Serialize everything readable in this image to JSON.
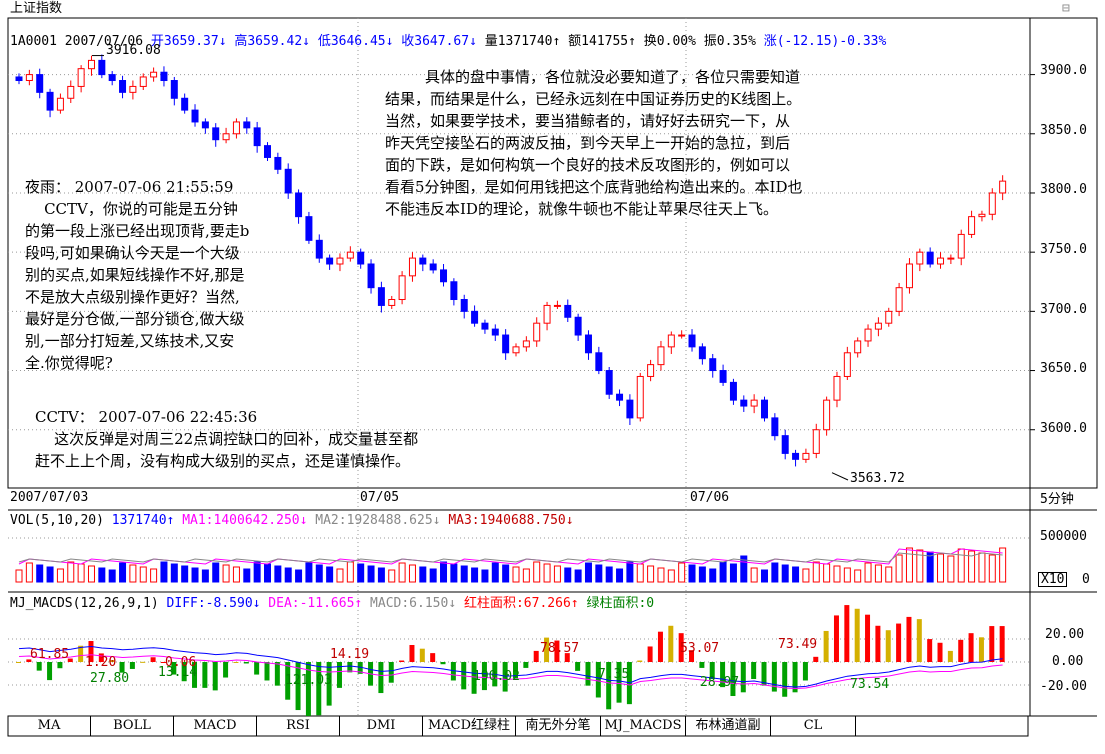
{
  "app_title": "上证指数",
  "corner_icon": "restore-icon",
  "info_line": {
    "code": "1A0001",
    "date": "2007/07/06",
    "open": "开3659.37",
    "high": "高3659.42",
    "low": "低3646.45",
    "close": "收3647.67",
    "volume": "量1371740",
    "amount": "额141755",
    "turnover": "换0.00%",
    "amplitude": "振0.35%",
    "change": "涨(-12.15)-0.33%",
    "arrow_down": "↓",
    "arrow_up": "↑"
  },
  "price_axis": [
    "3900.0",
    "3850.0",
    "3800.0",
    "3750.0",
    "3700.0",
    "3650.0",
    "3600.0"
  ],
  "price_labels": {
    "high_marker": "3916.08",
    "low_marker": "3563.72"
  },
  "date_axis": [
    "2007/07/03",
    "07/05",
    "07/06"
  ],
  "period": "5分钟",
  "notes": {
    "main": [
      "具体的盘中事情，各位就没必要知道了，各位只需要知道",
      "结果，而结果是什么，已经永远刻在中国证券历史的K线图上。",
      "当然，如果要学技术，要当猎鲸者的，请好好去研究一下，从",
      "昨天凭空接坠石的两波反抽，到今天早上一开始的急拉，到后",
      "面的下跌，是如何构筑一个良好的技术反攻图形的，例如可以",
      "看看5分钟图，是如何用钱把这个底背驰给构造出来的。本ID也",
      "不能违反本ID的理论，就像牛顿也不能让苹果尽往天上飞。"
    ],
    "q_header": "夜雨：  2007-07-06 21:55:59",
    "question": [
      "    CCTV，你说的可能是五分钟",
      "的第一段上涨已经出现顶背,要走b",
      "段吗,可如果确认今天是一个大级",
      "别的买点,如果短线操作不好,那是",
      "不是放大点级别操作更好？当然,",
      "最好是分仓做,一部分锁仓,做大级",
      "别,一部分打短差,又练技术,又安",
      "全.你觉得呢?"
    ],
    "a_header": "CCTV：  2007-07-06 22:45:36",
    "answer": [
      "    这次反弹是对周三22点调控缺口的回补，成交量甚至都",
      "赶不上上个周，没有构成大级别的买点，还是谨慎操作。"
    ]
  },
  "vol_panel": {
    "title": "VOL(5,10,20)",
    "value": "1371740",
    "ma1": "MA1:1400642.250",
    "ma2": "MA2:1928488.625",
    "ma3": "MA3:1940688.750",
    "axis_top": "500000",
    "axis_zero": "0",
    "unit": "X10"
  },
  "macd_panel": {
    "title": "MJ_MACDS(12,26,9,1)",
    "diff": "DIFF:-8.590",
    "dea": "DEA:-11.665",
    "macd": "MACD:6.150",
    "red_area": "红柱面积:67.266",
    "green_area": "绿柱面积:0",
    "axis": [
      "20.00",
      "0.00",
      "-20.00"
    ],
    "labels_above": [
      "61.85",
      "1.20",
      "0.06",
      "14.19",
      "78.57",
      "53.07",
      "73.49"
    ],
    "labels_below": [
      "27.80",
      "13.14",
      "121.03",
      "190.02",
      "7.35",
      "28.97",
      "73.54"
    ]
  },
  "tabs": [
    "MA",
    "BOLL",
    "MACD",
    "RSI",
    "DMI",
    "MACD红绿柱",
    "南无外分笔",
    "MJ_MACDS",
    "布林通道副",
    "CL"
  ],
  "colors": {
    "up": "#ff0000",
    "down": "#0000ff",
    "blue_text": "#0000ff",
    "magenta": "#ff00ff",
    "green": "#00a000",
    "yellow": "#d4b000"
  },
  "chart_data": {
    "type": "candlestick",
    "period": "5分钟",
    "price_range": [
      3555,
      3925
    ],
    "price_ticks": [
      3900,
      3850,
      3800,
      3750,
      3700,
      3650,
      3600
    ],
    "dates": [
      "2007/07/03",
      "07/05",
      "07/06"
    ],
    "high_marker": 3916.08,
    "low_marker": 3563.72,
    "close_path": [
      3895,
      3900,
      3885,
      3870,
      3880,
      3890,
      3905,
      3912,
      3900,
      3895,
      3885,
      3890,
      3898,
      3902,
      3895,
      3880,
      3870,
      3860,
      3855,
      3845,
      3850,
      3860,
      3855,
      3840,
      3830,
      3820,
      3800,
      3780,
      3760,
      3745,
      3740,
      3745,
      3750,
      3740,
      3720,
      3705,
      3710,
      3730,
      3745,
      3740,
      3735,
      3725,
      3710,
      3700,
      3690,
      3685,
      3680,
      3665,
      3670,
      3675,
      3690,
      3705,
      3705,
      3695,
      3680,
      3665,
      3650,
      3630,
      3625,
      3610,
      3645,
      3655,
      3670,
      3680,
      3680,
      3670,
      3660,
      3650,
      3640,
      3625,
      3620,
      3625,
      3610,
      3595,
      3580,
      3575,
      3580,
      3600,
      3625,
      3645,
      3665,
      3675,
      3685,
      3690,
      3700,
      3720,
      3740,
      3750,
      3740,
      3745,
      3745,
      3765,
      3780,
      3782,
      3800,
      3810
    ]
  }
}
